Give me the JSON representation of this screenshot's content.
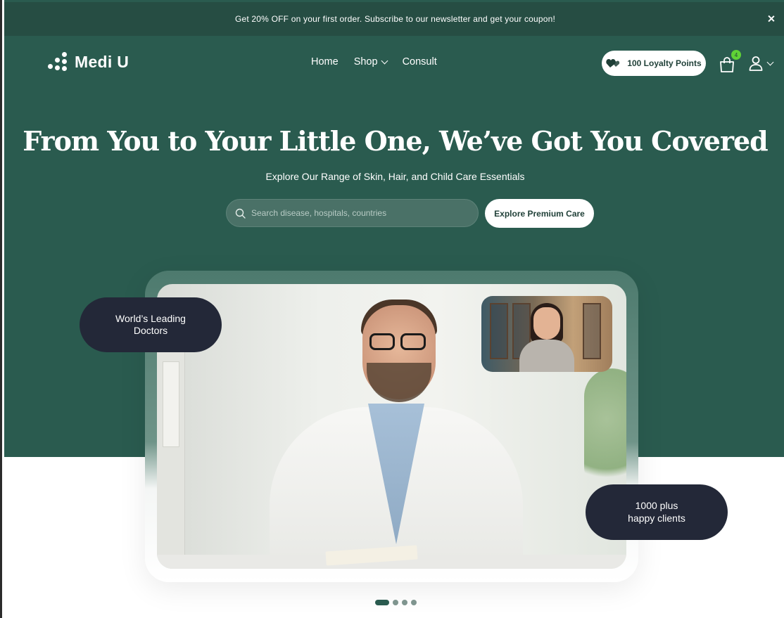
{
  "announcement": {
    "text": "Get 20% OFF on your first order. Subscribe to our newsletter and get your coupon!"
  },
  "header": {
    "brand": "Medi U",
    "nav": [
      {
        "label": "Home"
      },
      {
        "label": "Shop",
        "has_dropdown": true
      },
      {
        "label": "Consult"
      }
    ],
    "loyalty_label": "100 Loyalty Points",
    "cart_count": "4"
  },
  "hero": {
    "title": "From You to Your Little One, We’ve Got You Covered",
    "subtitle": "Explore Our Range of Skin, Hair, and Child Care Essentials",
    "search_placeholder": "Search disease, hospitals, countries",
    "search_value": "",
    "cta_label": "Explore Premium Care"
  },
  "badges": {
    "left_line1": "World’s Leading",
    "left_line2": "Doctors",
    "right_line1": "1000 plus",
    "right_line2": "happy clients"
  },
  "carousel": {
    "total_slides": 4,
    "active_index": 0
  },
  "colors": {
    "primary": "#2a5b4f",
    "announcement_bg": "#264d43",
    "badge_bg": "#232838",
    "cart_badge": "#5fd236"
  },
  "icons": [
    "logo-dots-icon",
    "chevron-down-icon",
    "heart-icon",
    "shopping-bag-icon",
    "user-icon",
    "search-icon",
    "close-icon"
  ]
}
